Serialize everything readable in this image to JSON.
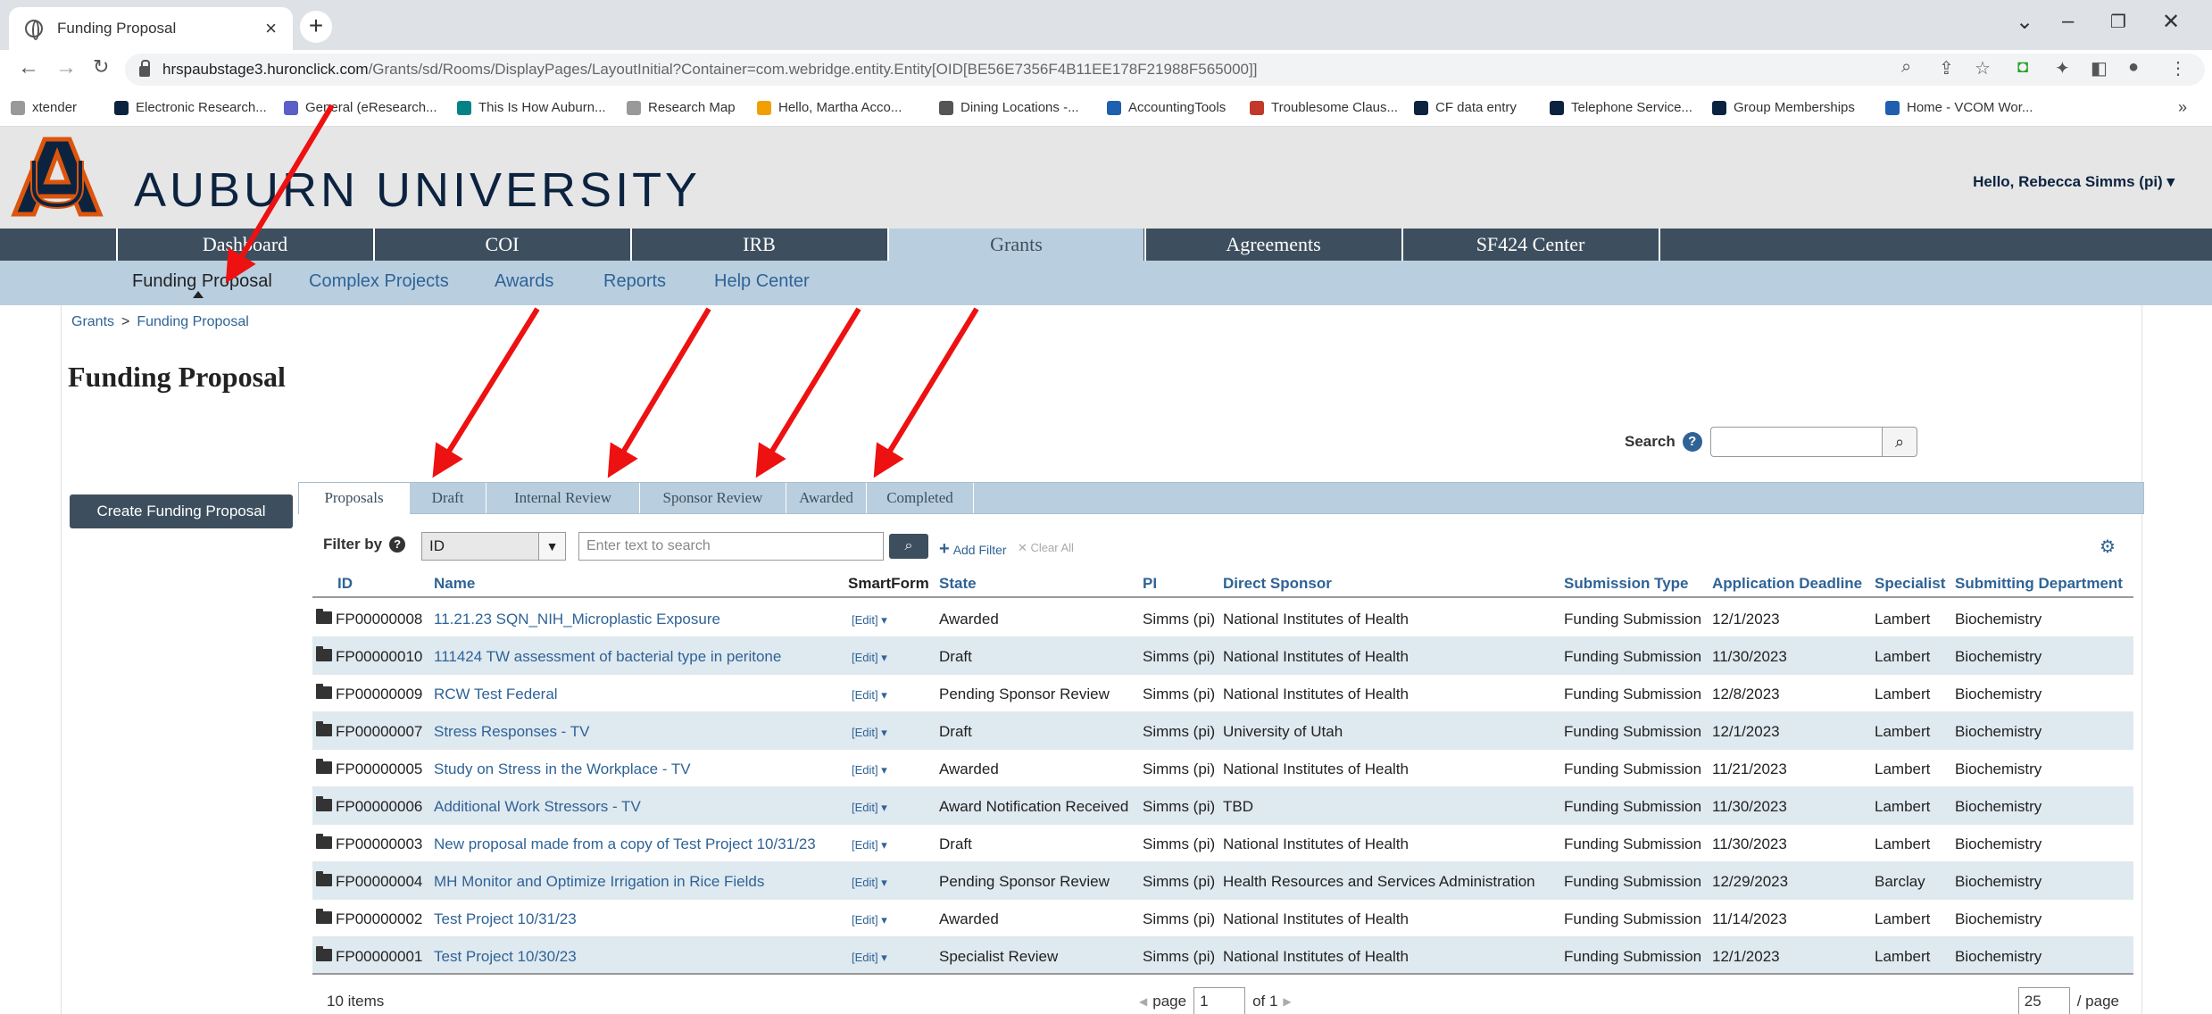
{
  "browser": {
    "tab_title": "Funding Proposal",
    "url_host": "hrspaubstage3.huronclick.com",
    "url_path": "/Grants/sd/Rooms/DisplayPages/LayoutInitial?Container=com.webridge.entity.Entity[OID[BE56E7356F4B11EE178F21988F565000]]",
    "bookmarks": [
      {
        "label": "xtender",
        "icon": "page-icon",
        "color": "#999999"
      },
      {
        "label": "Electronic Research...",
        "icon": "auburn-tiger-icon",
        "color": "#0c2340"
      },
      {
        "label": "General (eResearch...",
        "icon": "teams-icon",
        "color": "#5b5fc7"
      },
      {
        "label": "This Is How Auburn...",
        "icon": "sharepoint-icon",
        "color": "#038387"
      },
      {
        "label": "Research Map",
        "icon": "page-icon",
        "color": "#999999"
      },
      {
        "label": "Hello, Martha Acco...",
        "icon": "amazon-icon",
        "color": "#f0a000"
      },
      {
        "label": "Dining Locations -...",
        "icon": "globe-icon",
        "color": "#555555"
      },
      {
        "label": "AccountingTools",
        "icon": "accountingtools-icon",
        "color": "#1f5fb0"
      },
      {
        "label": "Troublesome Claus...",
        "icon": "stop-icon",
        "color": "#c0392b"
      },
      {
        "label": "CF data entry",
        "icon": "auburn-tiger-icon",
        "color": "#0c2340"
      },
      {
        "label": "Telephone Service...",
        "icon": "auburn-tiger-icon",
        "color": "#0c2340"
      },
      {
        "label": "Group Memberships",
        "icon": "auburn-tiger-icon",
        "color": "#0c2340"
      },
      {
        "label": "Home - VCOM Wor...",
        "icon": "sharepoint-icon",
        "color": "#1f5fb0"
      }
    ],
    "bookmarks_more": "»"
  },
  "site": {
    "name": "AUBURN UNIVERSITY",
    "greeting": "Hello,",
    "user": "Rebecca Simms (pi)",
    "main_nav": [
      {
        "label": "Dashboard",
        "active": false
      },
      {
        "label": "COI",
        "active": false
      },
      {
        "label": "IRB",
        "active": false
      },
      {
        "label": "Grants",
        "active": true
      },
      {
        "label": "Agreements",
        "active": false
      },
      {
        "label": "SF424 Center",
        "active": false
      }
    ],
    "sub_nav": [
      {
        "label": "Funding Proposal",
        "active": true
      },
      {
        "label": "Complex Projects",
        "active": false
      },
      {
        "label": "Awards",
        "active": false
      },
      {
        "label": "Reports",
        "active": false
      },
      {
        "label": "Help Center",
        "active": false
      }
    ]
  },
  "page": {
    "breadcrumb": [
      "Grants",
      "Funding Proposal"
    ],
    "breadcrumb_sep": ">",
    "title": "Funding Proposal",
    "search_label": "Search",
    "search_value": "",
    "create_button": "Create Funding Proposal"
  },
  "tabs": [
    {
      "label": "Proposals",
      "active": true
    },
    {
      "label": "Draft",
      "active": false
    },
    {
      "label": "Internal Review",
      "active": false
    },
    {
      "label": "Sponsor Review",
      "active": false
    },
    {
      "label": "Awarded",
      "active": false
    },
    {
      "label": "Completed",
      "active": false
    }
  ],
  "filter": {
    "label": "Filter by",
    "selected": "ID",
    "placeholder": "Enter text to search",
    "add_filter": "Add Filter",
    "clear_all": "Clear All"
  },
  "table": {
    "columns": [
      "ID",
      "Name",
      "SmartForm",
      "State",
      "PI",
      "Direct Sponsor",
      "Submission Type",
      "Application Deadline",
      "Specialist",
      "Submitting Department"
    ],
    "edit_label": "[Edit]",
    "rows": [
      {
        "id": "FP00000008",
        "name": "11.21.23 SQN_NIH_Microplastic Exposure",
        "state": "Awarded",
        "pi": "Simms (pi)",
        "sponsor": "National Institutes of Health",
        "type": "Funding Submission",
        "deadline": "12/1/2023",
        "specialist": "Lambert",
        "dept": "Biochemistry"
      },
      {
        "id": "FP00000010",
        "name": "111424 TW assessment of bacterial type in peritone",
        "state": "Draft",
        "pi": "Simms (pi)",
        "sponsor": "National Institutes of Health",
        "type": "Funding Submission",
        "deadline": "11/30/2023",
        "specialist": "Lambert",
        "dept": "Biochemistry"
      },
      {
        "id": "FP00000009",
        "name": "RCW Test Federal",
        "state": "Pending Sponsor Review",
        "pi": "Simms (pi)",
        "sponsor": "National Institutes of Health",
        "type": "Funding Submission",
        "deadline": "12/8/2023",
        "specialist": "Lambert",
        "dept": "Biochemistry"
      },
      {
        "id": "FP00000007",
        "name": "Stress Responses - TV",
        "state": "Draft",
        "pi": "Simms (pi)",
        "sponsor": "University of Utah",
        "type": "Funding Submission",
        "deadline": "12/1/2023",
        "specialist": "Lambert",
        "dept": "Biochemistry"
      },
      {
        "id": "FP00000005",
        "name": "Study on Stress in the Workplace - TV",
        "state": "Awarded",
        "pi": "Simms (pi)",
        "sponsor": "National Institutes of Health",
        "type": "Funding Submission",
        "deadline": "11/21/2023",
        "specialist": "Lambert",
        "dept": "Biochemistry"
      },
      {
        "id": "FP00000006",
        "name": "Additional Work Stressors - TV",
        "state": "Award Notification Received",
        "pi": "Simms (pi)",
        "sponsor": "TBD",
        "type": "Funding Submission",
        "deadline": "11/30/2023",
        "specialist": "Lambert",
        "dept": "Biochemistry"
      },
      {
        "id": "FP00000003",
        "name": "New proposal made from a copy of Test Project 10/31/23",
        "state": "Draft",
        "pi": "Simms (pi)",
        "sponsor": "National Institutes of Health",
        "type": "Funding Submission",
        "deadline": "11/30/2023",
        "specialist": "Lambert",
        "dept": "Biochemistry"
      },
      {
        "id": "FP00000004",
        "name": "MH Monitor and Optimize Irrigation in Rice Fields",
        "state": "Pending Sponsor Review",
        "pi": "Simms (pi)",
        "sponsor": "Health Resources and Services Administration",
        "type": "Funding Submission",
        "deadline": "12/29/2023",
        "specialist": "Barclay",
        "dept": "Biochemistry"
      },
      {
        "id": "FP00000002",
        "name": "Test Project 10/31/23",
        "state": "Awarded",
        "pi": "Simms (pi)",
        "sponsor": "National Institutes of Health",
        "type": "Funding Submission",
        "deadline": "11/14/2023",
        "specialist": "Lambert",
        "dept": "Biochemistry"
      },
      {
        "id": "FP00000001",
        "name": "Test Project 10/30/23",
        "state": "Specialist Review",
        "pi": "Simms (pi)",
        "sponsor": "National Institutes of Health",
        "type": "Funding Submission",
        "deadline": "12/1/2023",
        "specialist": "Lambert",
        "dept": "Biochemistry"
      }
    ]
  },
  "footer": {
    "items_count": "10 items",
    "page_label": "page",
    "page_value": "1",
    "of_label": "of 1",
    "per_page_value": "25",
    "per_page_label": "/ page"
  },
  "colors": {
    "nav_dark": "#3d4f5e",
    "nav_light": "#b9cfe0",
    "link": "#2f6396",
    "annotation_arrow": "#ee1111"
  }
}
